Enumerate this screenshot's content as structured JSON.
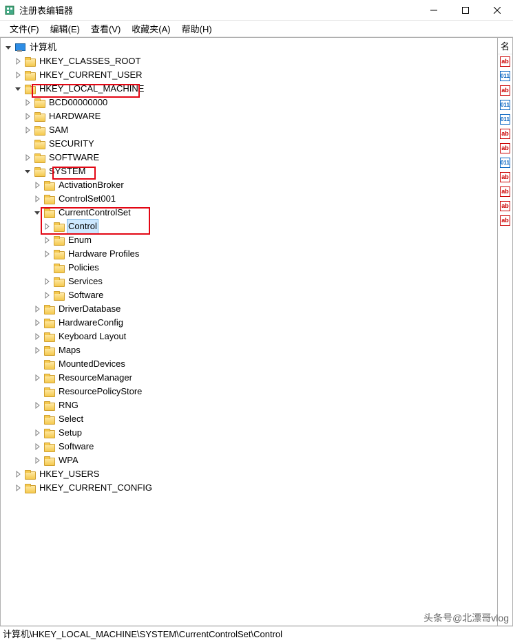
{
  "window": {
    "title": "注册表编辑器"
  },
  "menu": {
    "file": "文件(F)",
    "edit": "编辑(E)",
    "view": "查看(V)",
    "favorites": "收藏夹(A)",
    "help": "帮助(H)"
  },
  "right": {
    "header": "名",
    "icons": [
      "ab",
      "bn",
      "ab",
      "bn",
      "bn",
      "ab",
      "ab",
      "bn",
      "ab",
      "ab",
      "ab",
      "ab"
    ]
  },
  "tree": {
    "root": "计算机",
    "hkcr": "HKEY_CLASSES_ROOT",
    "hkcu": "HKEY_CURRENT_USER",
    "hklm": "HKEY_LOCAL_MACHINE",
    "bcd": "BCD00000000",
    "hardware": "HARDWARE",
    "sam": "SAM",
    "security": "SECURITY",
    "software_top": "SOFTWARE",
    "system": "SYSTEM",
    "activationbroker": "ActivationBroker",
    "controlset001": "ControlSet001",
    "currentcontrolset": "CurrentControlSet",
    "control": "Control",
    "enum": "Enum",
    "hwprofiles": "Hardware Profiles",
    "policies": "Policies",
    "services": "Services",
    "software_ccs": "Software",
    "driverdatabase": "DriverDatabase",
    "hardwareconfig": "HardwareConfig",
    "keyboardlayout": "Keyboard Layout",
    "maps": "Maps",
    "mounteddevices": "MountedDevices",
    "resourcemanager": "ResourceManager",
    "resourcepolicystore": "ResourcePolicyStore",
    "rng": "RNG",
    "select": "Select",
    "setup": "Setup",
    "software_sys": "Software",
    "wpa": "WPA",
    "hku": "HKEY_USERS",
    "hkcc": "HKEY_CURRENT_CONFIG"
  },
  "statusbar": "计算机\\HKEY_LOCAL_MACHINE\\SYSTEM\\CurrentControlSet\\Control",
  "watermark": "头条号@北漂哥vlog"
}
